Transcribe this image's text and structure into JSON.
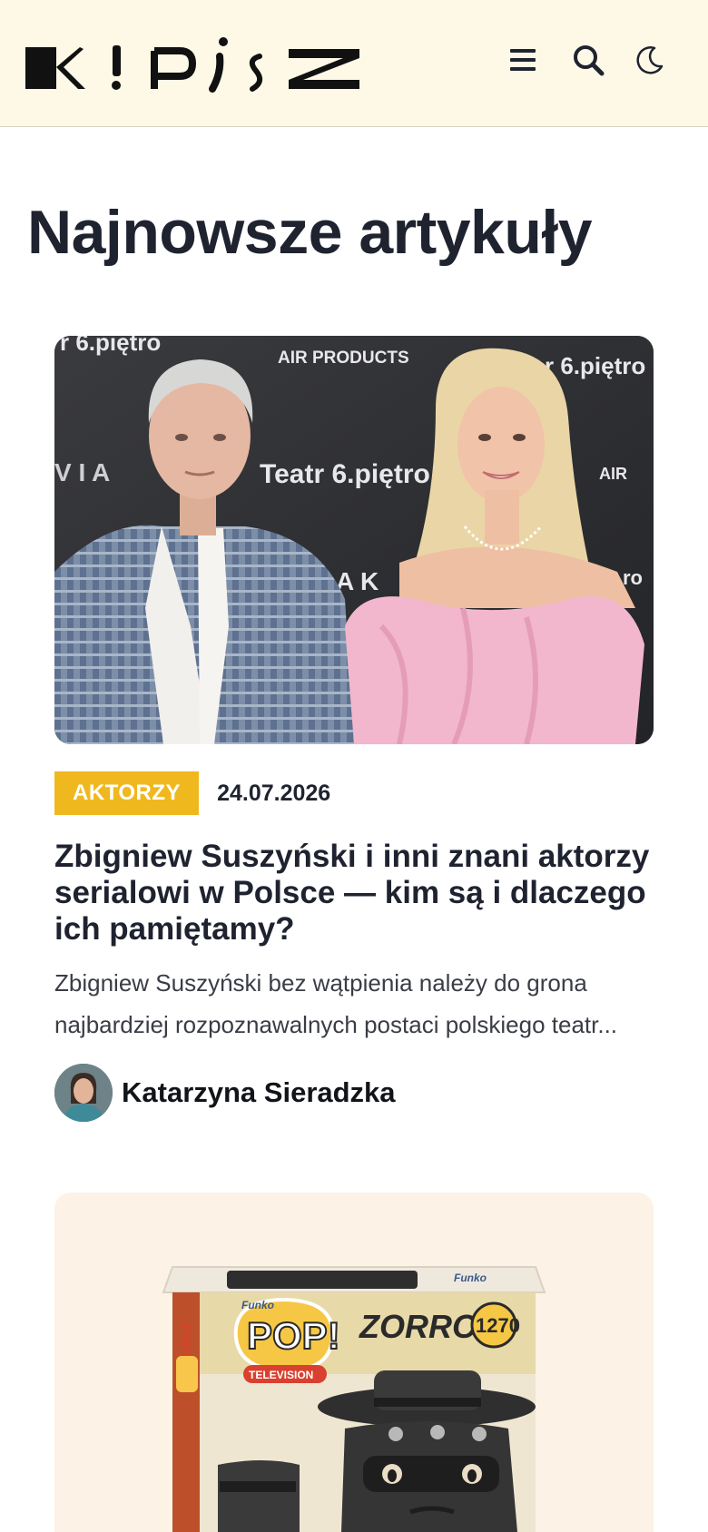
{
  "header": {
    "logo_text": "K!PiSZ",
    "menu_icon": "hamburger-icon",
    "search_icon": "search-icon",
    "theme_icon": "moon-icon",
    "background": "#fdf9e6"
  },
  "main": {
    "title": "Najnowsze artykuły"
  },
  "articles": [
    {
      "category": "AKTORZY",
      "category_color": "#f0b81f",
      "date": "24.07.2026",
      "title": "Zbigniew Suszyński i inni znani aktorzy serialowi w Polsce — kim są i dlaczego ich pamiętamy?",
      "excerpt": "Zbigniew Suszyński bez wątpienia należy do grona najbardziej rozpoznawalnych postaci polskiego teatr...",
      "author": "Katarzyna Sieradzka",
      "image_backdrop_texts": [
        "r 6.piętro",
        "AIR PRODUCTS",
        "r 6.piętro",
        "Teatr 6.piętro",
        "AIR",
        "AIR",
        "ro",
        "A K",
        "6"
      ]
    },
    {
      "image_texts": [
        "POP!",
        "TELEVISION",
        "Funko",
        "ZORRO",
        "1270",
        "POP!",
        "Funko"
      ]
    }
  ]
}
